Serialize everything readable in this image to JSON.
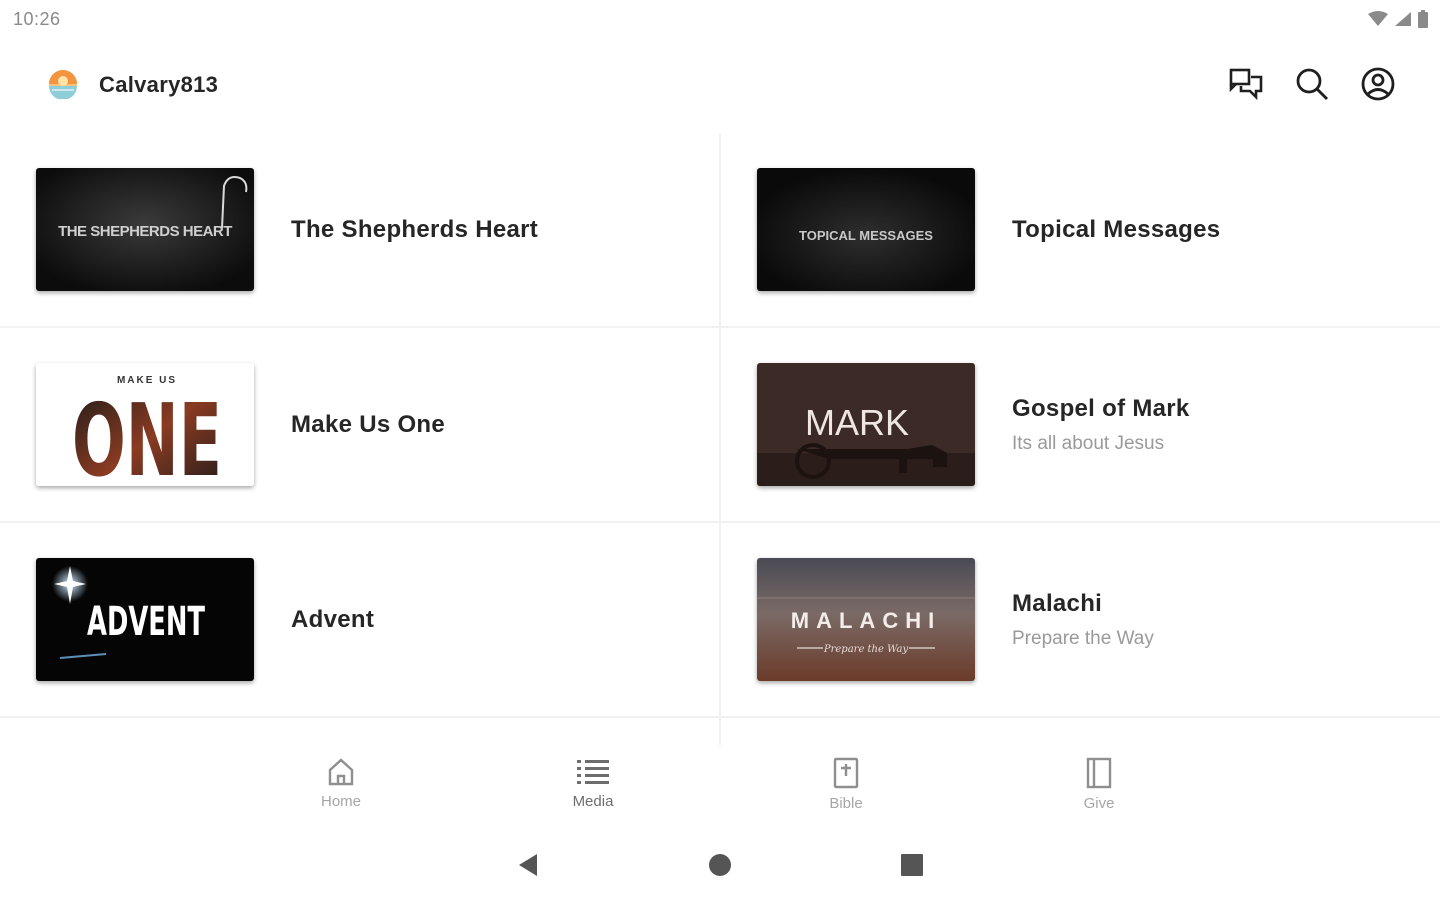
{
  "status_bar": {
    "time": "10:26"
  },
  "app": {
    "title": "Calvary813"
  },
  "series": [
    {
      "title": "The Shepherds Heart",
      "subtitle": "",
      "thumb_text": "THE SHEPHERDS HEART"
    },
    {
      "title": "Topical Messages",
      "subtitle": "",
      "thumb_text": "TOPICAL MESSAGES"
    },
    {
      "title": "Make Us One",
      "subtitle": "",
      "thumb_small": "MAKE US",
      "thumb_text": "ONE"
    },
    {
      "title": "Gospel of Mark",
      "subtitle": "Its all about Jesus",
      "thumb_text": "MARK"
    },
    {
      "title": "Advent",
      "subtitle": "",
      "thumb_text": "ADVENT"
    },
    {
      "title": "Malachi",
      "subtitle": "Prepare the Way",
      "thumb_text": "MALACHI",
      "thumb_small": "Prepare the Way"
    }
  ],
  "bottom_nav": [
    {
      "label": "Home",
      "icon": "home-icon"
    },
    {
      "label": "Media",
      "icon": "list-icon"
    },
    {
      "label": "Bible",
      "icon": "bible-icon"
    },
    {
      "label": "Give",
      "icon": "give-icon"
    }
  ],
  "colors": {
    "text": "#262626",
    "muted": "#9a9a9a",
    "divider": "#f1f1f1"
  }
}
